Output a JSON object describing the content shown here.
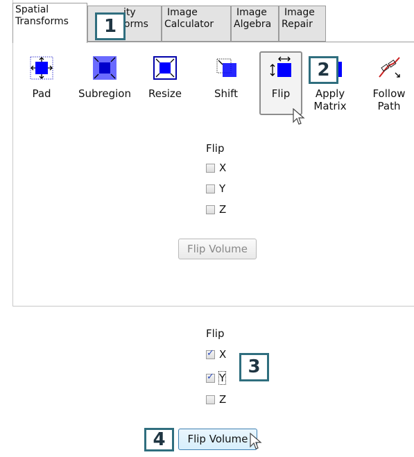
{
  "tabs": [
    {
      "line1": "Spatial",
      "line2": "Transforms"
    },
    {
      "line1": "ity",
      "line2": "forms"
    },
    {
      "line1": "Image",
      "line2": "Calculator"
    },
    {
      "line1": "Image",
      "line2": "Algebra"
    },
    {
      "line1": "Image",
      "line2": "Repair"
    }
  ],
  "tools": {
    "pad": "Pad",
    "subregion": "Subregion",
    "resize": "Resize",
    "shift": "Shift",
    "flip": "Flip",
    "apply_matrix": [
      "Apply",
      "Matrix"
    ],
    "follow_path": [
      "Follow",
      "Path"
    ]
  },
  "callouts": [
    "1",
    "2",
    "3",
    "4"
  ],
  "flip_top": {
    "title": "Flip",
    "x": "X",
    "y": "Y",
    "z": "Z",
    "button": "Flip Volume"
  },
  "flip_bottom": {
    "title": "Flip",
    "x": "X",
    "y": "Y",
    "z": "Z",
    "x_checked": true,
    "y_checked": true,
    "z_checked": false,
    "button": "Flip Volume"
  },
  "colors": {
    "accent": "#0000ff",
    "callout_border": "#2f6e7e"
  }
}
